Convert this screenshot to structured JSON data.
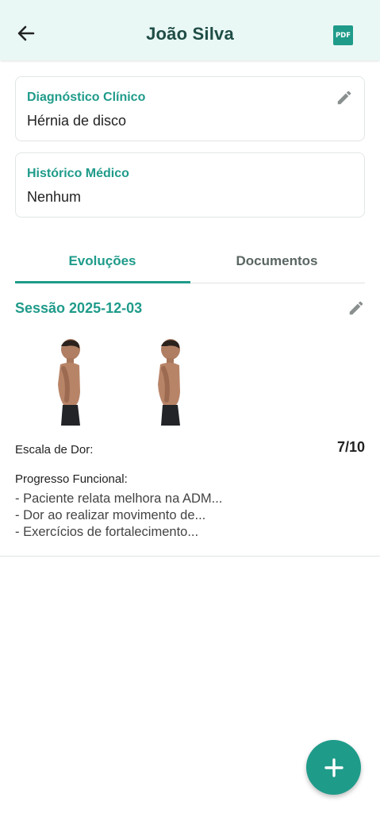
{
  "header": {
    "title": "João Silva",
    "back_icon": "arrow-left-icon",
    "pdf_icon": "pdf-icon",
    "pdf_label": "PDF"
  },
  "diagnosis": {
    "label": "Diagnóstico Clínico",
    "value": "Hérnia de disco"
  },
  "history": {
    "label": "Histórico Médico",
    "value": "Nenhum"
  },
  "tabs": [
    {
      "label": "Evoluções",
      "active": true
    },
    {
      "label": "Documentos",
      "active": false
    }
  ],
  "session": {
    "title": "Sessão 2025-12-03",
    "pain_label": "Escala de Dor:",
    "pain_value": "7/10",
    "progress_label": "Progresso Funcional:",
    "progress_lines": [
      "- Paciente relata melhora na ADM...",
      "- Dor ao realizar movimento de...",
      "- Exercícios de fortalecimento..."
    ]
  },
  "fab": {
    "icon": "plus-icon"
  },
  "colors": {
    "accent": "#1f9b8a",
    "header_bg": "#eaf8f5"
  }
}
